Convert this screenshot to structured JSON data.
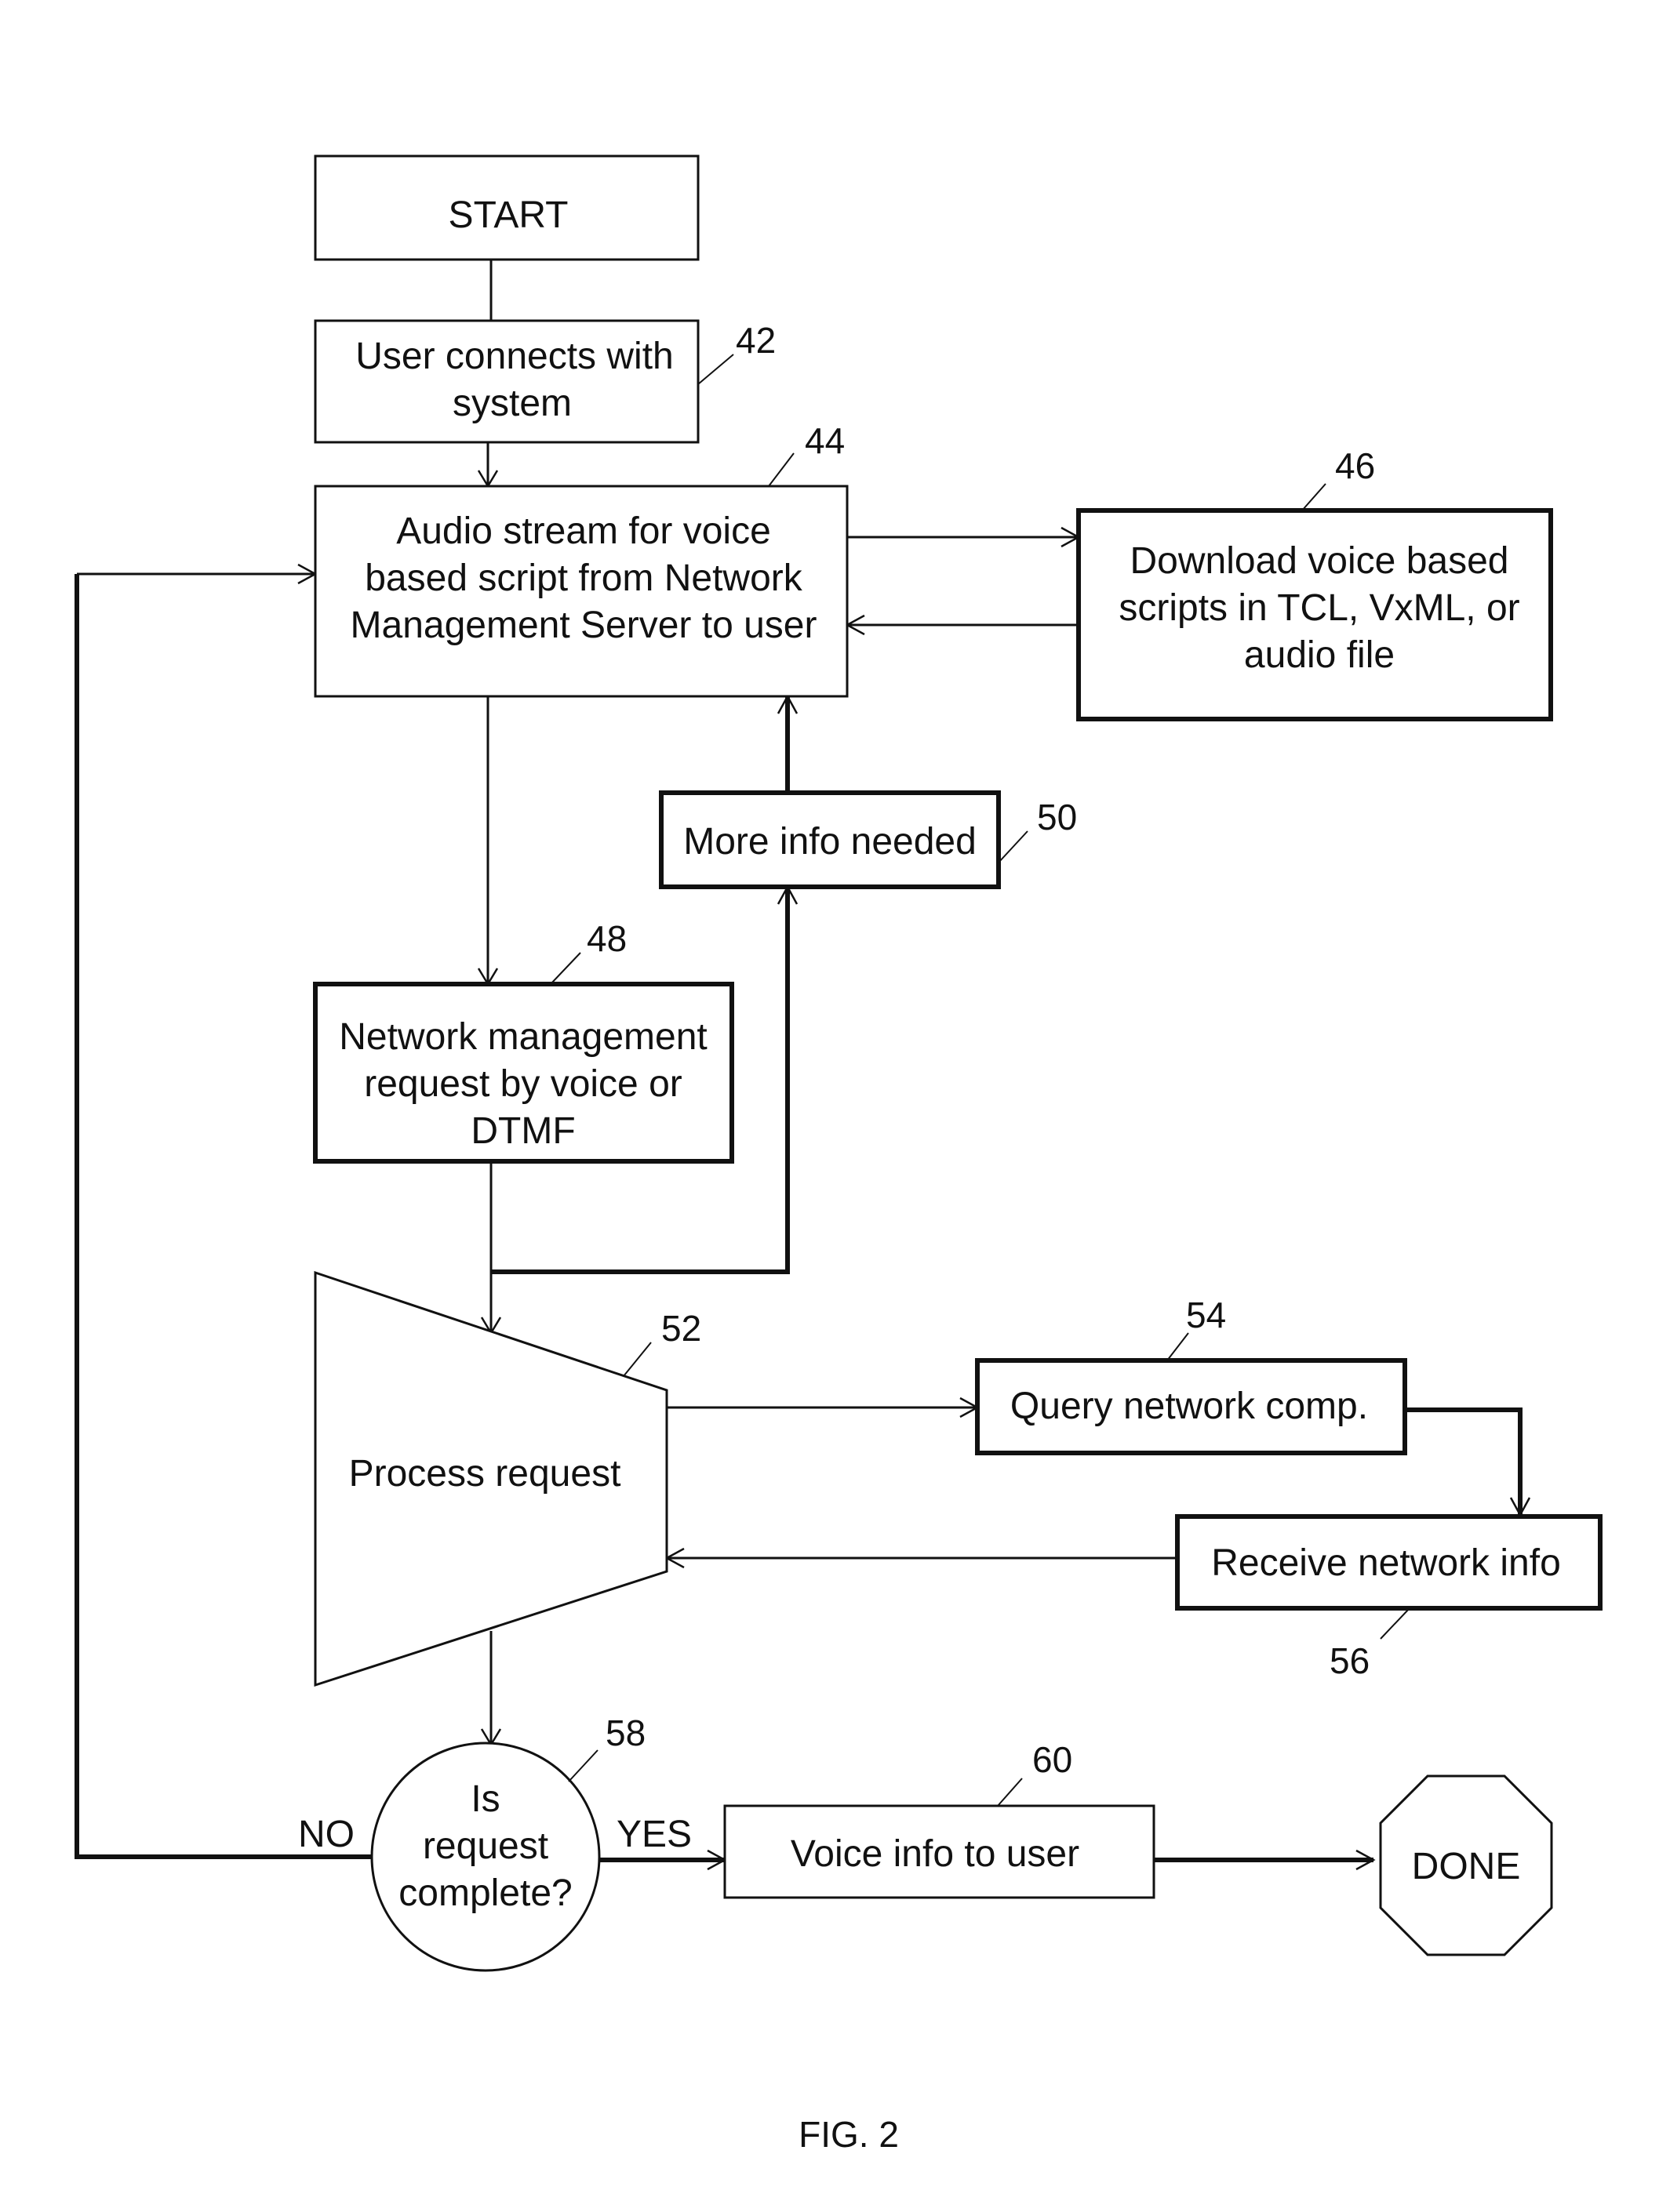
{
  "figure": {
    "caption": "FIG. 2",
    "nodes": {
      "start": {
        "lines": [
          "START"
        ]
      },
      "n42": {
        "ref": "42",
        "lines": [
          "User connects with",
          "system"
        ]
      },
      "n44": {
        "ref": "44",
        "lines": [
          "Audio stream for voice",
          "based script from Network",
          "Management Server to user"
        ]
      },
      "n46": {
        "ref": "46",
        "lines": [
          "Download voice based",
          "scripts in TCL, VxML, or",
          "audio file"
        ]
      },
      "n48": {
        "ref": "48",
        "lines": [
          "Network management",
          "request by voice or",
          "DTMF"
        ]
      },
      "n50": {
        "ref": "50",
        "lines": [
          "More info needed"
        ]
      },
      "n52": {
        "ref": "52",
        "lines": [
          "Process request"
        ]
      },
      "n54": {
        "ref": "54",
        "lines": [
          "Query network comp."
        ]
      },
      "n56": {
        "ref": "56",
        "lines": [
          "Receive network info"
        ]
      },
      "n58": {
        "ref": "58",
        "lines": [
          "Is",
          "request",
          "complete?"
        ]
      },
      "n60": {
        "ref": "60",
        "lines": [
          "Voice info to user"
        ]
      },
      "done": {
        "lines": [
          "DONE"
        ]
      }
    },
    "edge_labels": {
      "no": "NO",
      "yes": "YES"
    }
  }
}
